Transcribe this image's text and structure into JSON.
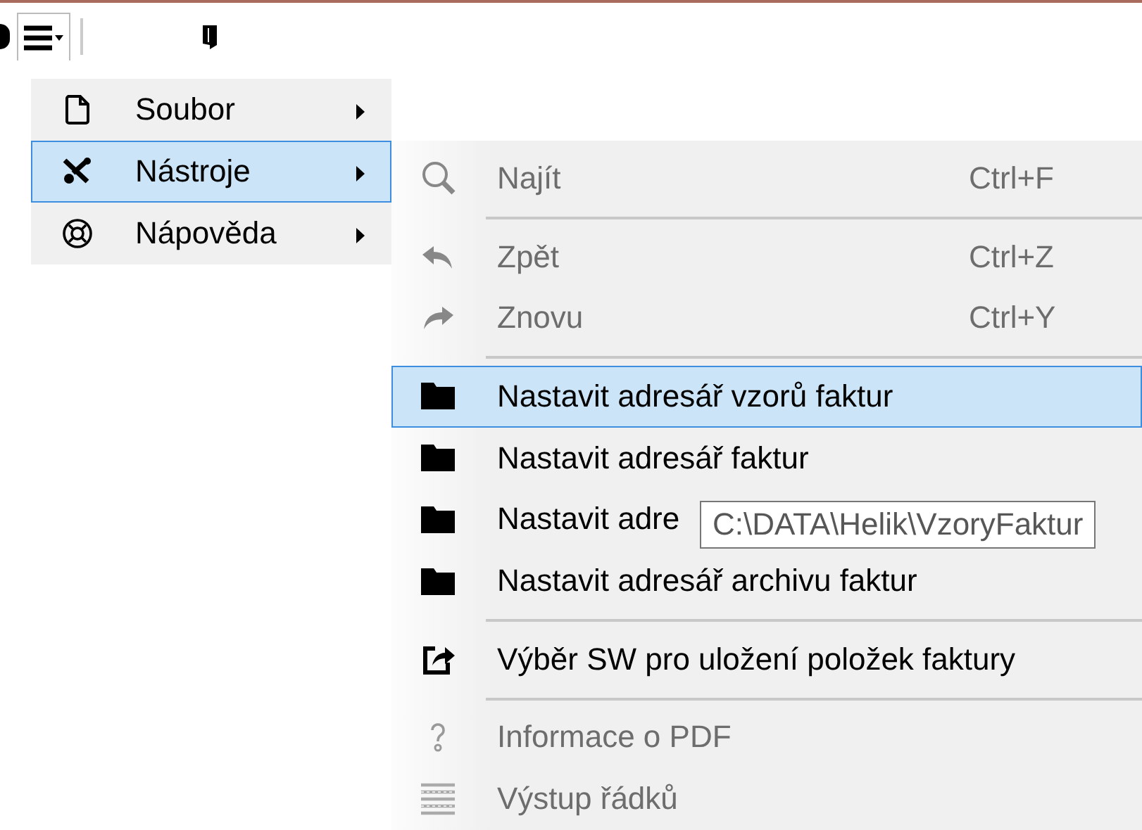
{
  "main_menu": {
    "items": [
      {
        "label": "Soubor",
        "selected": false,
        "has_submenu": true
      },
      {
        "label": "Nástroje",
        "selected": true,
        "has_submenu": true
      },
      {
        "label": "Nápověda",
        "selected": false,
        "has_submenu": true
      }
    ]
  },
  "submenu": {
    "items": [
      {
        "kind": "item",
        "label": "Najít",
        "shortcut": "Ctrl+F",
        "disabled": true,
        "selected": false
      },
      {
        "kind": "separator"
      },
      {
        "kind": "item",
        "label": "Zpět",
        "shortcut": "Ctrl+Z",
        "disabled": true,
        "selected": false
      },
      {
        "kind": "item",
        "label": "Znovu",
        "shortcut": "Ctrl+Y",
        "disabled": true,
        "selected": false
      },
      {
        "kind": "separator"
      },
      {
        "kind": "item",
        "label": "Nastavit adresář vzorů faktur",
        "disabled": false,
        "selected": true
      },
      {
        "kind": "item",
        "label": "Nastavit adresář faktur",
        "disabled": false,
        "selected": false
      },
      {
        "kind": "item",
        "label": "Nastavit adre",
        "disabled": false,
        "selected": false
      },
      {
        "kind": "item",
        "label": "Nastavit adresář archivu faktur",
        "disabled": false,
        "selected": false
      },
      {
        "kind": "separator"
      },
      {
        "kind": "item",
        "label": "Výběr SW pro uložení položek faktury",
        "disabled": false,
        "selected": false
      },
      {
        "kind": "separator"
      },
      {
        "kind": "item",
        "label": "Informace o PDF",
        "disabled": true,
        "selected": false
      },
      {
        "kind": "item",
        "label": "Výstup řádků",
        "disabled": true,
        "selected": false
      }
    ]
  },
  "tooltip": {
    "text": "C:\\DATA\\Helik\\VzoryFaktur"
  }
}
